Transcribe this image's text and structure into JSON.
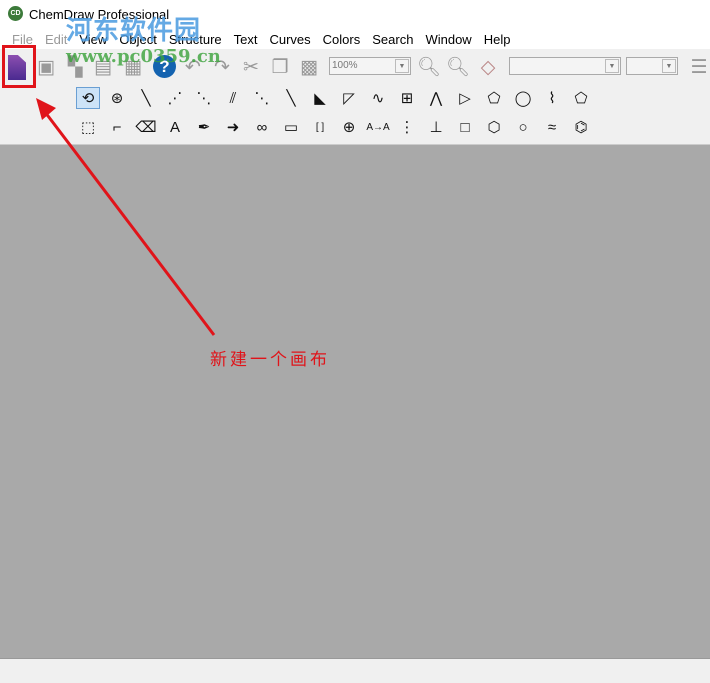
{
  "window": {
    "title": "ChemDraw Professional",
    "icon_label": "CD"
  },
  "menu": [
    "File",
    "Edit",
    "View",
    "Object",
    "Structure",
    "Text",
    "Curves",
    "Colors",
    "Search",
    "Window",
    "Help"
  ],
  "toolbar": {
    "zoom_value": "100%",
    "font_value": "",
    "size_value": ""
  },
  "tools_row1": [
    {
      "name": "lasso",
      "g": "⟲"
    },
    {
      "name": "structure-perspective",
      "g": "⊛"
    },
    {
      "name": "solid-bond",
      "g": "╲"
    },
    {
      "name": "double-bond",
      "g": "⋰"
    },
    {
      "name": "dashed-bond",
      "g": "⋱"
    },
    {
      "name": "hashed-bond",
      "g": "⫽"
    },
    {
      "name": "hashed-wedge-bond",
      "g": "⋱"
    },
    {
      "name": "bold-bond",
      "g": "╲"
    },
    {
      "name": "wedge-bond",
      "g": "◣"
    },
    {
      "name": "hollow-wedge-bond",
      "g": "◸"
    },
    {
      "name": "wavy-bond",
      "g": "∿"
    },
    {
      "name": "table",
      "g": "⊞"
    },
    {
      "name": "chain",
      "g": "⋀"
    },
    {
      "name": "triangle",
      "g": "▷"
    },
    {
      "name": "pentagon",
      "g": "⬠"
    },
    {
      "name": "heptagon",
      "g": "◯"
    },
    {
      "name": "cyclohexane-chair",
      "g": "⌇"
    },
    {
      "name": "cyclopentadiene",
      "g": "⬠"
    }
  ],
  "tools_row2": [
    {
      "name": "marquee",
      "g": "⬚"
    },
    {
      "name": "mass-fragmentation",
      "g": "⌐"
    },
    {
      "name": "eraser",
      "g": "⌫"
    },
    {
      "name": "text",
      "g": "A"
    },
    {
      "name": "pen",
      "g": "✒"
    },
    {
      "name": "arrow",
      "g": "➜"
    },
    {
      "name": "orbital",
      "g": "∞"
    },
    {
      "name": "drawing-elements",
      "g": "▭"
    },
    {
      "name": "brackets",
      "g": "[ ]"
    },
    {
      "name": "chemical-symbols",
      "g": "⊕"
    },
    {
      "name": "query",
      "g": "A→A"
    },
    {
      "name": "template",
      "g": "⋮"
    },
    {
      "name": "stamp",
      "g": "⊥"
    },
    {
      "name": "cyclopropane-square",
      "g": "□"
    },
    {
      "name": "hexagon",
      "g": "⬡"
    },
    {
      "name": "octagon",
      "g": "○"
    },
    {
      "name": "cyclohexane-chair-2",
      "g": "≈"
    },
    {
      "name": "benzene",
      "g": "⌬"
    }
  ],
  "annotation": "新建一个画布",
  "watermark": {
    "name": "河东软件园",
    "url": "www.pc0359.cn"
  },
  "colors": {
    "highlight": "#e0141a",
    "canvas": "#a9a9a9"
  }
}
